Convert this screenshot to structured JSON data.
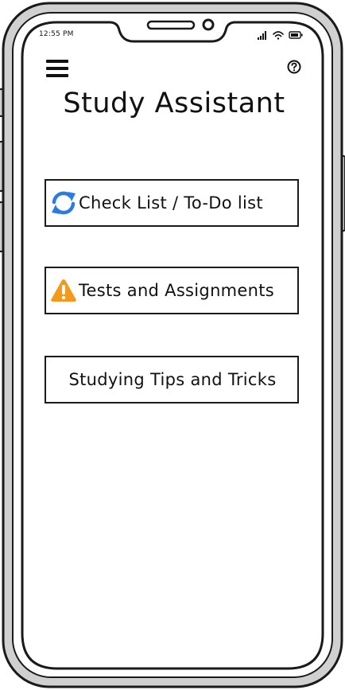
{
  "status_bar": {
    "time": "12:55 PM",
    "icons": [
      "cellular-signal-icon",
      "wifi-icon",
      "battery-icon"
    ]
  },
  "header": {
    "menu_icon": "hamburger-menu-icon",
    "help_icon": "help-icon",
    "title": "Study Assistant"
  },
  "menu": {
    "items": [
      {
        "label": "Check List / To-Do list",
        "icon": "refresh-icon",
        "icon_color": "#2b7be0"
      },
      {
        "label": "Tests and Assignments",
        "icon": "warning-icon",
        "icon_color": "#f39a1d"
      },
      {
        "label": "Studying Tips and Tricks"
      }
    ]
  }
}
